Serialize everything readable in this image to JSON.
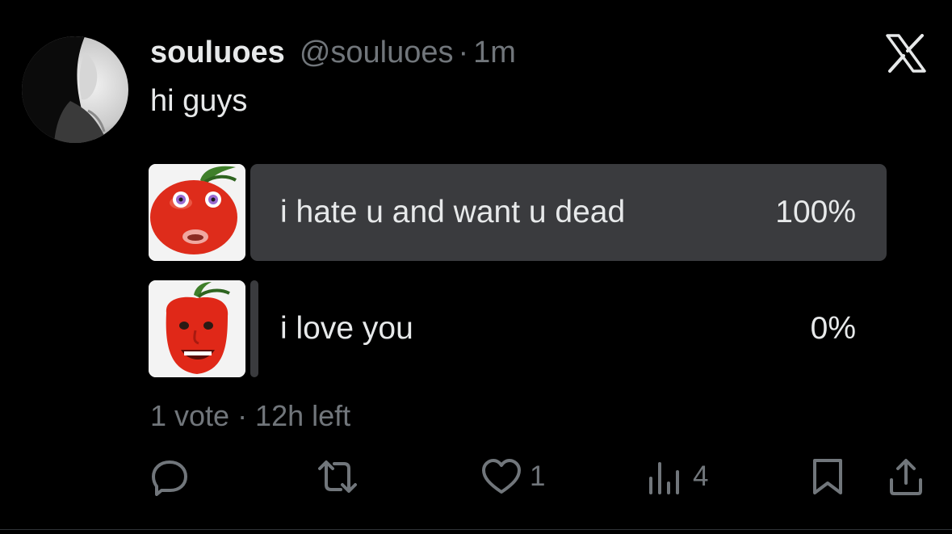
{
  "tweet": {
    "display_name": "souluoes",
    "handle": "@souluoes",
    "separator": "·",
    "time": "1m",
    "text": "hi guys"
  },
  "poll": {
    "options": [
      {
        "label": "i hate u and want u dead",
        "percent_text": "100%",
        "percent": 100
      },
      {
        "label": "i love you",
        "percent_text": "0%",
        "percent": 0
      }
    ],
    "meta": "1 vote · 12h left"
  },
  "actions": {
    "reply_icon": "reply-icon",
    "retweet_icon": "retweet-icon",
    "like_icon": "heart-icon",
    "like_count": "1",
    "views_icon": "views-icon",
    "views_count": "4",
    "bookmark_icon": "bookmark-icon",
    "share_icon": "share-icon"
  },
  "colors": {
    "background": "#000000",
    "primary_text": "#e7e9ea",
    "secondary_text": "#71767b",
    "winning_bar": "#3a3b3e"
  }
}
